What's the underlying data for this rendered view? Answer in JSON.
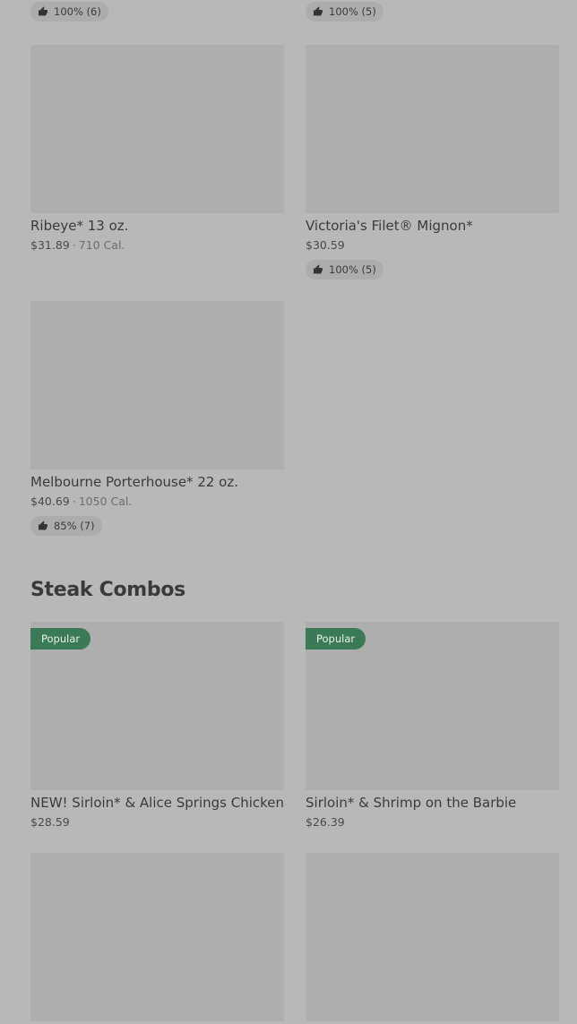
{
  "top_ratings": [
    {
      "label": "100% (6)"
    },
    {
      "label": "100% (5)"
    }
  ],
  "steaks": [
    {
      "title": "Ribeye* 13 oz.",
      "price": "$31.89",
      "cal": "710 Cal."
    },
    {
      "title": "Victoria's Filet® Mignon*",
      "price": "$30.59",
      "rating": "100% (5)"
    },
    {
      "title": "Melbourne Porterhouse* 22 oz.",
      "price": "$40.69",
      "cal": "1050 Cal.",
      "rating": "85% (7)"
    }
  ],
  "section": {
    "title": "Steak Combos"
  },
  "combos": [
    {
      "badge": "Popular",
      "title": "NEW! Sirloin* & Alice Springs Chicken",
      "price": "$28.59"
    },
    {
      "badge": "Popular",
      "title": "Sirloin* & Shrimp on the Barbie",
      "price": "$26.39"
    }
  ],
  "icons": {
    "rating": "thumbs-up-icon"
  },
  "colors": {
    "badge": "#3b7a56",
    "background": "#b8b8b8",
    "image_placeholder": "#aeaeae"
  }
}
